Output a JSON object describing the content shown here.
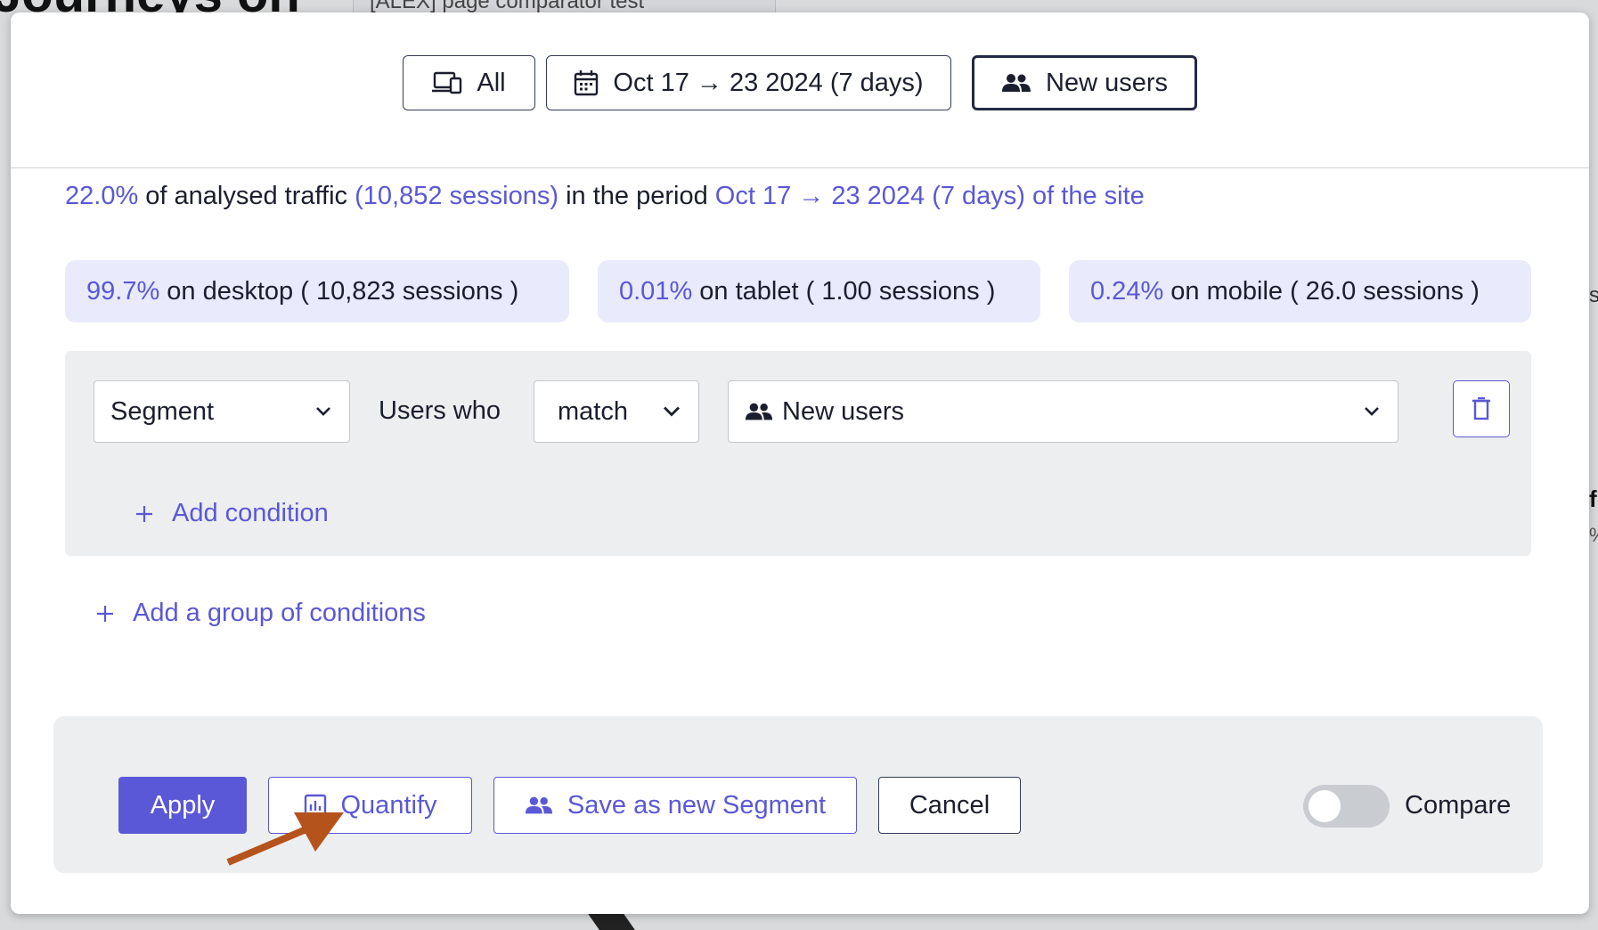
{
  "background": {
    "page_title": "Journeys on",
    "selector_label": "[ALEX] page comparator test"
  },
  "header": {
    "device_button": {
      "label": "All",
      "icon": "devices-icon"
    },
    "date_button": {
      "label": "Oct 17 → 23 2024 (7 days)",
      "icon": "calendar-icon"
    },
    "segment_button": {
      "label": "New users",
      "icon": "users-icon",
      "active": true
    }
  },
  "summary": {
    "percent": "22.0%",
    "text1": "of analysed traffic",
    "sessions": "(10,852 sessions)",
    "text2": "in the period",
    "period": "Oct 17 → 23 2024 (7 days) of the site"
  },
  "devices": [
    {
      "percent": "99.7%",
      "label": "on desktop ( 10,823 sessions )"
    },
    {
      "percent": "0.01%",
      "label": "on tablet ( 1.00 sessions )"
    },
    {
      "percent": "0.24%",
      "label": "on mobile ( 26.0 sessions )"
    }
  ],
  "condition": {
    "type_select": "Segment",
    "users_who": "Users who",
    "match_select": "match",
    "segment_select": "New users",
    "add_condition": "Add condition"
  },
  "add_group": "Add a group of conditions",
  "footer": {
    "apply": "Apply",
    "quantify": "Quantify",
    "save_segment": "Save as new Segment",
    "cancel": "Cancel",
    "compare": "Compare",
    "compare_on": false
  },
  "colors": {
    "accent": "#5a58d6",
    "chip_bg": "#e9eafb",
    "panel_bg": "#eceef0",
    "annotation_arrow": "#b5531c"
  }
}
